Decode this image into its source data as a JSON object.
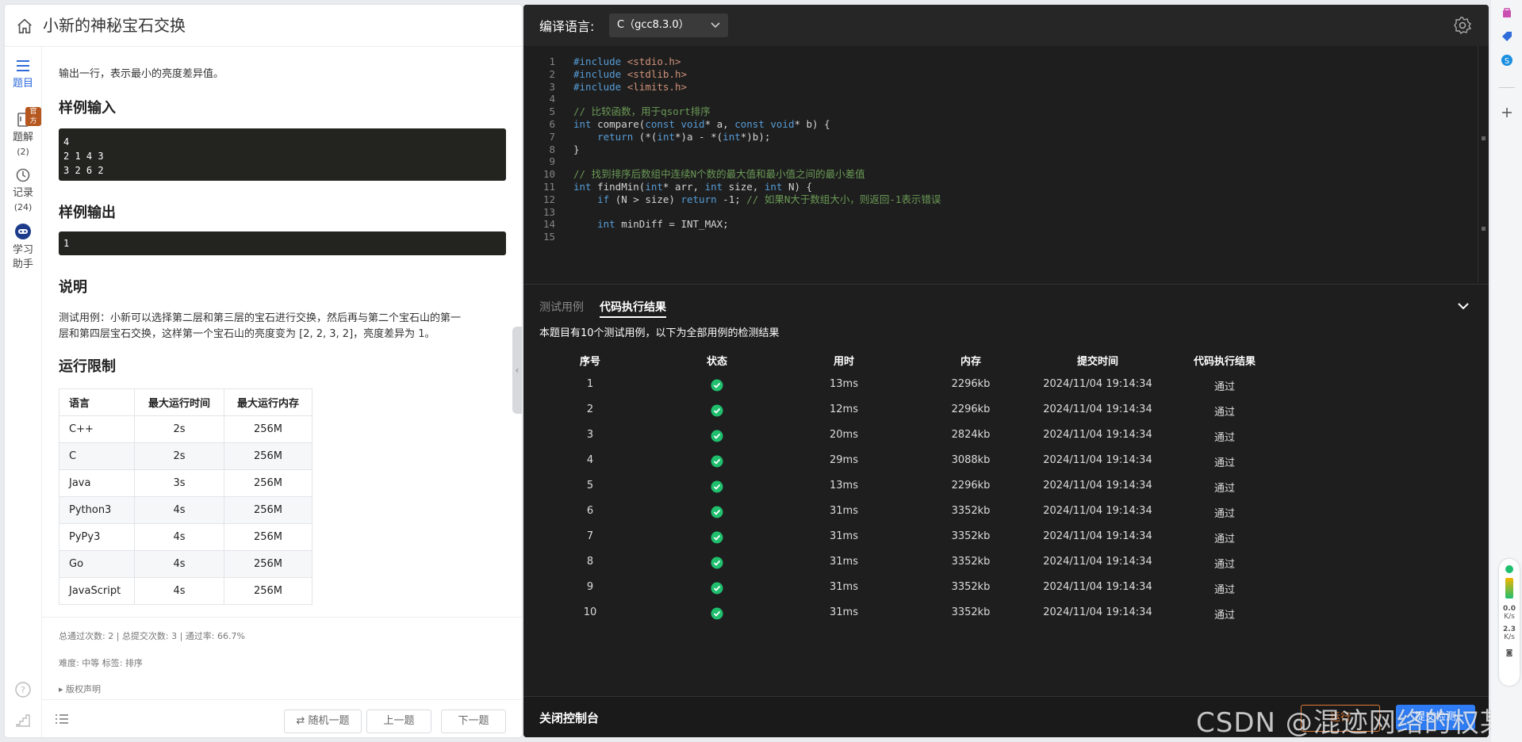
{
  "problem": {
    "title": "小新的神秘宝石交换"
  },
  "rail": [
    {
      "label": "题目"
    },
    {
      "label": "题解",
      "count": "(2)",
      "badge": "官方"
    },
    {
      "label": "记录",
      "count": "(24)"
    },
    {
      "label": "学习",
      "label2": "助手"
    }
  ],
  "output_desc": "输出一行，表示最小的亮度差异值。",
  "sections": {
    "sample_input": "样例输入",
    "sample_output": "样例输出",
    "explain": "说明",
    "limits": "运行限制"
  },
  "sample_input_lines": [
    "4",
    "2 1 4 3",
    "3 2 6 2"
  ],
  "sample_output_lines": [
    "1"
  ],
  "explain_lines": [
    "测试用例：小新可以选择第二层和第三层的宝石进行交换，然后再与第二个宝石山的第一",
    "层和第四层宝石交换，这样第一个宝石山的亮度变为 [2, 2, 3, 2]，亮度差异为 1。"
  ],
  "limits_table": {
    "headers": [
      "语言",
      "最大运行时间",
      "最大运行内存"
    ],
    "rows": [
      [
        "C++",
        "2s",
        "256M"
      ],
      [
        "C",
        "2s",
        "256M"
      ],
      [
        "Java",
        "3s",
        "256M"
      ],
      [
        "Python3",
        "4s",
        "256M"
      ],
      [
        "PyPy3",
        "4s",
        "256M"
      ],
      [
        "Go",
        "4s",
        "256M"
      ],
      [
        "JavaScript",
        "4s",
        "256M"
      ]
    ]
  },
  "stats": "总通过次数: 2  |  总提交次数: 3  |  通过率: 66.7%",
  "meta": "难度: 中等    标签: 排序",
  "copyright": "版权声明",
  "nav": {
    "random": "随机一题",
    "prev": "上一题",
    "next": "下一题"
  },
  "editor": {
    "lang_label": "编译语言:",
    "lang_value": "C（gcc8.3.0）"
  },
  "code_lines": [
    {
      "n": "1",
      "html": "<span class=\"kw\">#include</span> <span class=\"str\">&lt;stdio.h&gt;</span>"
    },
    {
      "n": "2",
      "html": "<span class=\"kw\">#include</span> <span class=\"str\">&lt;stdlib.h&gt;</span>"
    },
    {
      "n": "3",
      "html": "<span class=\"kw\">#include</span> <span class=\"str\">&lt;limits.h&gt;</span>"
    },
    {
      "n": "4",
      "html": ""
    },
    {
      "n": "5",
      "html": "<span class=\"cm\">// 比较函数，用于qsort排序</span>"
    },
    {
      "n": "6",
      "html": "<span class=\"kw\">int</span> compare(<span class=\"kw\">const void</span>* a, <span class=\"kw\">const void</span>* b) {"
    },
    {
      "n": "7",
      "html": "    <span class=\"kw\">return</span> (*(<span class=\"kw\">int</span>*)a - *(<span class=\"kw\">int</span>*)b);"
    },
    {
      "n": "8",
      "html": "}"
    },
    {
      "n": "9",
      "html": ""
    },
    {
      "n": "10",
      "html": "<span class=\"cm\">// 找到排序后数组中连续N个数的最大值和最小值之间的最小差值</span>"
    },
    {
      "n": "11",
      "html": "<span class=\"kw\">int</span> findMin(<span class=\"kw\">int</span>* arr, <span class=\"kw\">int</span> size, <span class=\"kw\">int</span> N) {"
    },
    {
      "n": "12",
      "html": "    <span class=\"kw\">if</span> (N &gt; size) <span class=\"kw\">return</span> -1; <span class=\"cm\">// 如果N大于数组大小，则返回-1表示错误</span>"
    },
    {
      "n": "13",
      "html": ""
    },
    {
      "n": "14",
      "html": "    <span class=\"kw\">int</span> minDiff = INT_MAX;"
    },
    {
      "n": "15",
      "html": ""
    }
  ],
  "console": {
    "tab_tests": "测试用例",
    "tab_result": "代码执行结果",
    "summary": "本题目有10个测试用例，以下为全部用例的检测结果",
    "headers": [
      "序号",
      "状态",
      "用时",
      "内存",
      "提交时间",
      "代码执行结果"
    ],
    "rows": [
      [
        "1",
        "13ms",
        "2296kb",
        "2024/11/04 19:14:34",
        "通过"
      ],
      [
        "2",
        "12ms",
        "2296kb",
        "2024/11/04 19:14:34",
        "通过"
      ],
      [
        "3",
        "20ms",
        "2824kb",
        "2024/11/04 19:14:34",
        "通过"
      ],
      [
        "4",
        "29ms",
        "3088kb",
        "2024/11/04 19:14:34",
        "通过"
      ],
      [
        "5",
        "13ms",
        "2296kb",
        "2024/11/04 19:14:34",
        "通过"
      ],
      [
        "6",
        "31ms",
        "3352kb",
        "2024/11/04 19:14:34",
        "通过"
      ],
      [
        "7",
        "31ms",
        "3352kb",
        "2024/11/04 19:14:34",
        "通过"
      ],
      [
        "8",
        "31ms",
        "3352kb",
        "2024/11/04 19:14:34",
        "通过"
      ],
      [
        "9",
        "31ms",
        "3352kb",
        "2024/11/04 19:14:34",
        "通过"
      ],
      [
        "10",
        "31ms",
        "3352kb",
        "2024/11/04 19:14:34",
        "通过"
      ]
    ],
    "close": "关闭控制台",
    "run": "运行",
    "submit": "提交检测"
  },
  "watermark": "CSDN @混迹网络的权某",
  "perf": {
    "up": "0.0",
    "up_unit": "K/s",
    "down": "2.3",
    "down_unit": "K/s"
  },
  "colors": {
    "accent": "#2e7df6",
    "pass": "#1fbf6e",
    "run": "#e07b39"
  }
}
